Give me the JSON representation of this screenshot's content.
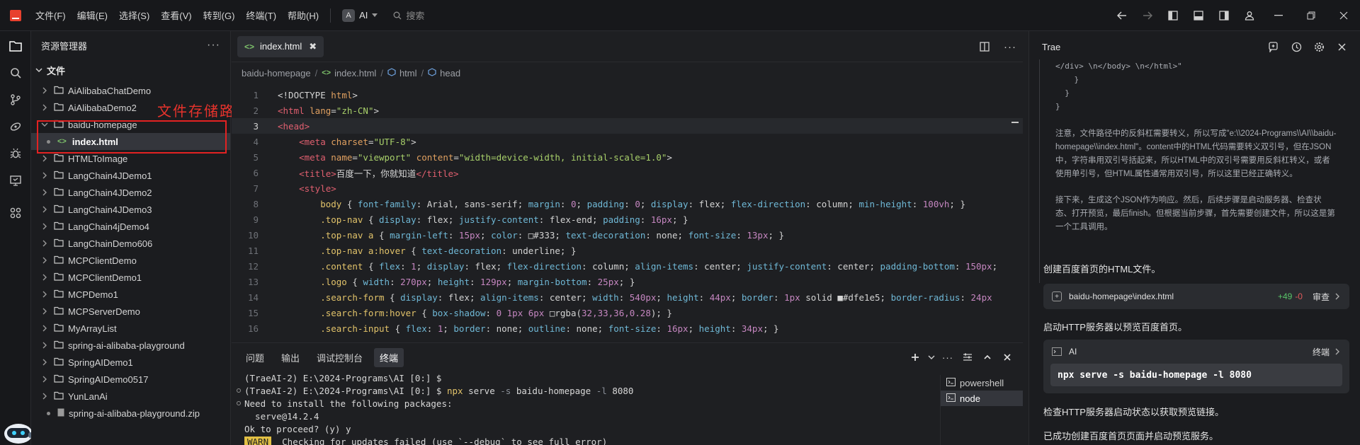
{
  "menu": [
    "文件(F)",
    "编辑(E)",
    "选择(S)",
    "查看(V)",
    "转到(G)",
    "终端(T)",
    "帮助(H)"
  ],
  "ai_selector": {
    "badge": "A",
    "label": "AI"
  },
  "search": {
    "placeholder": "搜索"
  },
  "explorer": {
    "title": "资源管理器",
    "more": "···",
    "section": "文件",
    "folders": [
      "AiAlibabaChatDemo",
      "AiAlibabaDemo2",
      "baidu-homepage",
      "HTMLToImage",
      "LangChain4JDemo1",
      "LangChain4JDemo2",
      "LangChain4JDemo3",
      "LangChain4jDemo4",
      "LangChainDemo606",
      "MCPClientDemo",
      "MCPClientDemo1",
      "MCPDemo1",
      "MCPServerDemo",
      "MyArrayList",
      "spring-ai-alibaba-playground",
      "SpringAIDemo1",
      "SpringAIDemo0517",
      "YunLanAi"
    ],
    "open_file": "index.html",
    "zip_file": "spring-ai-alibaba-playground.zip",
    "annotation": "文件存储路径",
    "annotation_color": "#e32222"
  },
  "editor": {
    "tab": {
      "label": "index.html",
      "close": "✖"
    },
    "breadcrumb": [
      "baidu-homepage",
      "index.html",
      "html",
      "head"
    ],
    "current_line": 3,
    "lines": [
      [
        [
          "<!DOCTYPE ",
          "#d4d4d4"
        ],
        [
          "html",
          "#e0a060"
        ],
        [
          ">",
          "#d4d4d4"
        ]
      ],
      [
        [
          "<html ",
          "#e05f6f"
        ],
        [
          "lang",
          "#e0a060"
        ],
        [
          "=",
          "#d4d4d4"
        ],
        [
          "\"zh-CN\"",
          "#a8d06a"
        ],
        [
          ">",
          "#d4d4d4"
        ]
      ],
      [
        [
          "<head>",
          "#e05f6f"
        ]
      ],
      [
        [
          "    <meta ",
          "#e05f6f"
        ],
        [
          "charset",
          "#e0a060"
        ],
        [
          "=",
          "#d4d4d4"
        ],
        [
          "\"UTF-8\"",
          "#a8d06a"
        ],
        [
          ">",
          "#d4d4d4"
        ]
      ],
      [
        [
          "    <meta ",
          "#e05f6f"
        ],
        [
          "name",
          "#e0a060"
        ],
        [
          "=",
          "#d4d4d4"
        ],
        [
          "\"viewport\" ",
          "#a8d06a"
        ],
        [
          "content",
          "#e0a060"
        ],
        [
          "=",
          "#d4d4d4"
        ],
        [
          "\"width=device-width, initial-scale=1.0\"",
          "#a8d06a"
        ],
        [
          ">",
          "#d4d4d4"
        ]
      ],
      [
        [
          "    <title>",
          "#e05f6f"
        ],
        [
          "百度一下，你就知道",
          "#d4d4d4"
        ],
        [
          "</title>",
          "#e05f6f"
        ]
      ],
      [
        [
          "    <style>",
          "#e05f6f"
        ]
      ],
      [
        [
          "        body ",
          "#e2c36a"
        ],
        [
          "{ ",
          "#d4d4d4"
        ],
        [
          "font-family",
          "#6fb8d6"
        ],
        [
          ": Arial, sans-serif; ",
          "#d4d4d4"
        ],
        [
          "margin",
          "#6fb8d6"
        ],
        [
          ": ",
          "#d4d4d4"
        ],
        [
          "0",
          "#c586c0"
        ],
        [
          "; ",
          "#d4d4d4"
        ],
        [
          "padding",
          "#6fb8d6"
        ],
        [
          ": ",
          "#d4d4d4"
        ],
        [
          "0",
          "#c586c0"
        ],
        [
          "; ",
          "#d4d4d4"
        ],
        [
          "display",
          "#6fb8d6"
        ],
        [
          ": flex; ",
          "#d4d4d4"
        ],
        [
          "flex-direction",
          "#6fb8d6"
        ],
        [
          ": column; ",
          "#d4d4d4"
        ],
        [
          "min-height",
          "#6fb8d6"
        ],
        [
          ": ",
          "#d4d4d4"
        ],
        [
          "100vh",
          "#c586c0"
        ],
        [
          "; }",
          "#d4d4d4"
        ]
      ],
      [
        [
          "        .top-nav ",
          "#e2c36a"
        ],
        [
          "{ ",
          "#d4d4d4"
        ],
        [
          "display",
          "#6fb8d6"
        ],
        [
          ": flex; ",
          "#d4d4d4"
        ],
        [
          "justify-content",
          "#6fb8d6"
        ],
        [
          ": flex-end; ",
          "#d4d4d4"
        ],
        [
          "padding",
          "#6fb8d6"
        ],
        [
          ": ",
          "#d4d4d4"
        ],
        [
          "16px",
          "#c586c0"
        ],
        [
          "; }",
          "#d4d4d4"
        ]
      ],
      [
        [
          "        .top-nav a ",
          "#e2c36a"
        ],
        [
          "{ ",
          "#d4d4d4"
        ],
        [
          "margin-left",
          "#6fb8d6"
        ],
        [
          ": ",
          "#d4d4d4"
        ],
        [
          "15px",
          "#c586c0"
        ],
        [
          "; ",
          "#d4d4d4"
        ],
        [
          "color",
          "#6fb8d6"
        ],
        [
          ": □#333; ",
          "#d4d4d4"
        ],
        [
          "text-decoration",
          "#6fb8d6"
        ],
        [
          ": none; ",
          "#d4d4d4"
        ],
        [
          "font-size",
          "#6fb8d6"
        ],
        [
          ": ",
          "#d4d4d4"
        ],
        [
          "13px",
          "#c586c0"
        ],
        [
          "; }",
          "#d4d4d4"
        ]
      ],
      [
        [
          "        .top-nav a:hover ",
          "#e2c36a"
        ],
        [
          "{ ",
          "#d4d4d4"
        ],
        [
          "text-decoration",
          "#6fb8d6"
        ],
        [
          ": underline; }",
          "#d4d4d4"
        ]
      ],
      [
        [
          "        .content ",
          "#e2c36a"
        ],
        [
          "{ ",
          "#d4d4d4"
        ],
        [
          "flex",
          "#6fb8d6"
        ],
        [
          ": ",
          "#d4d4d4"
        ],
        [
          "1",
          "#c586c0"
        ],
        [
          "; ",
          "#d4d4d4"
        ],
        [
          "display",
          "#6fb8d6"
        ],
        [
          ": flex; ",
          "#d4d4d4"
        ],
        [
          "flex-direction",
          "#6fb8d6"
        ],
        [
          ": column; ",
          "#d4d4d4"
        ],
        [
          "align-items",
          "#6fb8d6"
        ],
        [
          ": center; ",
          "#d4d4d4"
        ],
        [
          "justify-content",
          "#6fb8d6"
        ],
        [
          ": center; ",
          "#d4d4d4"
        ],
        [
          "padding-bottom",
          "#6fb8d6"
        ],
        [
          ": ",
          "#d4d4d4"
        ],
        [
          "150px",
          "#c586c0"
        ],
        [
          ";",
          "#d4d4d4"
        ]
      ],
      [
        [
          "        .logo ",
          "#e2c36a"
        ],
        [
          "{ ",
          "#d4d4d4"
        ],
        [
          "width",
          "#6fb8d6"
        ],
        [
          ": ",
          "#d4d4d4"
        ],
        [
          "270px",
          "#c586c0"
        ],
        [
          "; ",
          "#d4d4d4"
        ],
        [
          "height",
          "#6fb8d6"
        ],
        [
          ": ",
          "#d4d4d4"
        ],
        [
          "129px",
          "#c586c0"
        ],
        [
          "; ",
          "#d4d4d4"
        ],
        [
          "margin-bottom",
          "#6fb8d6"
        ],
        [
          ": ",
          "#d4d4d4"
        ],
        [
          "25px",
          "#c586c0"
        ],
        [
          "; }",
          "#d4d4d4"
        ]
      ],
      [
        [
          "        .search-form ",
          "#e2c36a"
        ],
        [
          "{ ",
          "#d4d4d4"
        ],
        [
          "display",
          "#6fb8d6"
        ],
        [
          ": flex; ",
          "#d4d4d4"
        ],
        [
          "align-items",
          "#6fb8d6"
        ],
        [
          ": center; ",
          "#d4d4d4"
        ],
        [
          "width",
          "#6fb8d6"
        ],
        [
          ": ",
          "#d4d4d4"
        ],
        [
          "540px",
          "#c586c0"
        ],
        [
          "; ",
          "#d4d4d4"
        ],
        [
          "height",
          "#6fb8d6"
        ],
        [
          ": ",
          "#d4d4d4"
        ],
        [
          "44px",
          "#c586c0"
        ],
        [
          "; ",
          "#d4d4d4"
        ],
        [
          "border",
          "#6fb8d6"
        ],
        [
          ": ",
          "#d4d4d4"
        ],
        [
          "1px",
          "#c586c0"
        ],
        [
          " solid ■#dfe1e5; ",
          "#d4d4d4"
        ],
        [
          "border-radius",
          "#6fb8d6"
        ],
        [
          ": ",
          "#d4d4d4"
        ],
        [
          "24px",
          "#c586c0"
        ]
      ],
      [
        [
          "        .search-form:hover ",
          "#e2c36a"
        ],
        [
          "{ ",
          "#d4d4d4"
        ],
        [
          "box-shadow",
          "#6fb8d6"
        ],
        [
          ": ",
          "#d4d4d4"
        ],
        [
          "0 1px 6px",
          "#c586c0"
        ],
        [
          " □rgba(",
          "#d4d4d4"
        ],
        [
          "32,33,36,0.28",
          "#c586c0"
        ],
        [
          "); }",
          "#d4d4d4"
        ]
      ],
      [
        [
          "        .search-input ",
          "#e2c36a"
        ],
        [
          "{ ",
          "#d4d4d4"
        ],
        [
          "flex",
          "#6fb8d6"
        ],
        [
          ": ",
          "#d4d4d4"
        ],
        [
          "1",
          "#c586c0"
        ],
        [
          "; ",
          "#d4d4d4"
        ],
        [
          "border",
          "#6fb8d6"
        ],
        [
          ": none; ",
          "#d4d4d4"
        ],
        [
          "outline",
          "#6fb8d6"
        ],
        [
          ": none; ",
          "#d4d4d4"
        ],
        [
          "font-size",
          "#6fb8d6"
        ],
        [
          ": ",
          "#d4d4d4"
        ],
        [
          "16px",
          "#c586c0"
        ],
        [
          "; ",
          "#d4d4d4"
        ],
        [
          "height",
          "#6fb8d6"
        ],
        [
          ": ",
          "#d4d4d4"
        ],
        [
          "34px",
          "#c586c0"
        ],
        [
          "; }",
          "#d4d4d4"
        ]
      ]
    ]
  },
  "panel": {
    "tabs": [
      "问题",
      "输出",
      "调试控制台",
      "终端"
    ],
    "active_tab": 3,
    "terminal_lines": [
      {
        "dot": false,
        "text": "(TraeAI-2) E:\\2024-Programs\\AI [0:] $"
      },
      {
        "dot": true,
        "prefix": "(TraeAI-2) E:\\2024-Programs\\AI [0:] $ ",
        "cmd": "npx",
        "rest": " serve ",
        "flag1": "-s",
        "arg1": " baidu-homepage ",
        "flag2": "-l",
        "arg2": " 8080"
      },
      {
        "dot": true,
        "text": "Need to install the following packages:"
      },
      {
        "dot": false,
        "text": "  serve@14.2.4"
      },
      {
        "dot": false,
        "text": "Ok to proceed? (y) y"
      },
      {
        "dot": false,
        "warn": "WARN",
        "text": "  Checking for updates failed (use `--debug` to see full error)"
      }
    ],
    "terminals": [
      "powershell",
      "node"
    ],
    "active_terminal": 1
  },
  "chat": {
    "title": "Trae",
    "thought_code": [
      "</div> \\n</body> \\n</html>\"",
      "    }",
      "  }",
      "}"
    ],
    "thought_paragraphs": [
      "注意，文件路径中的反斜杠需要转义，所以写成\"e:\\\\2024-Programs\\\\AI\\\\baidu-homepage\\\\index.html\"。content中的HTML代码需要转义双引号，但在JSON中，字符串用双引号括起来，所以HTML中的双引号需要用反斜杠转义，或者使用单引号，但HTML属性通常用双引号，所以这里已经正确转义。",
      "接下来，生成这个JSON作为响应。然后，后续步骤是启动服务器、检查状态、打开预览，最后finish。但根据当前步骤，首先需要创建文件，所以这是第一个工具调用。"
    ],
    "step1": "创建百度首页的HTML文件。",
    "file_card": {
      "path": "baidu-homepage\\index.html",
      "added": "+49",
      "removed": "-0",
      "action": "审查"
    },
    "step2": "启动HTTP服务器以预览百度首页。",
    "cmd_card": {
      "label": "AI",
      "action": "终端",
      "command": "npx serve -s baidu-homepage -l 8080"
    },
    "step3": "检查HTTP服务器启动状态以获取预览链接。",
    "step4": "已成功创建百度首页页面并启动预览服务。"
  }
}
